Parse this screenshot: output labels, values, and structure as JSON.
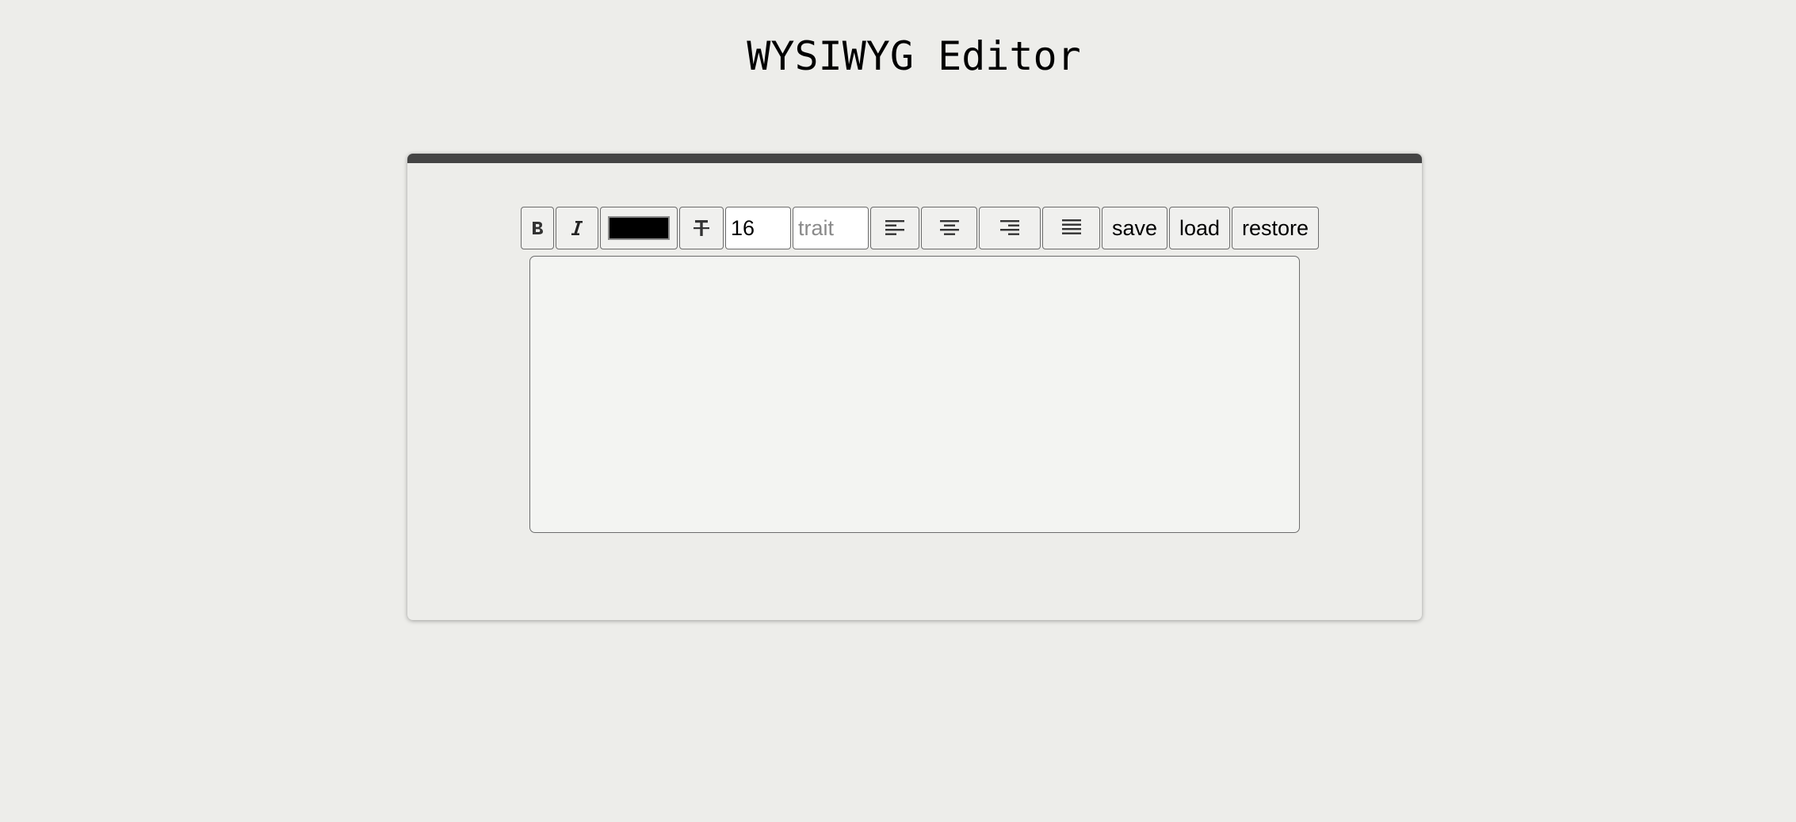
{
  "title": "WYSIWYG Editor",
  "toolbar": {
    "bold_icon": "bold-icon",
    "italic_icon": "italic-icon",
    "text_color": "#000000",
    "strikethrough_icon": "strikethrough-icon",
    "font_size_value": "16",
    "font_family_placeholder": "trait",
    "align_left_icon": "align-left-icon",
    "align_center_icon": "align-center-icon",
    "align_right_icon": "align-right-icon",
    "align_justify_icon": "align-justify-icon",
    "save_label": "save",
    "load_label": "load",
    "restore_label": "restore"
  },
  "editor": {
    "content": ""
  },
  "colors": {
    "background": "#ededea",
    "card_topbar": "#444444",
    "editor_bg": "#f3f4f2"
  }
}
